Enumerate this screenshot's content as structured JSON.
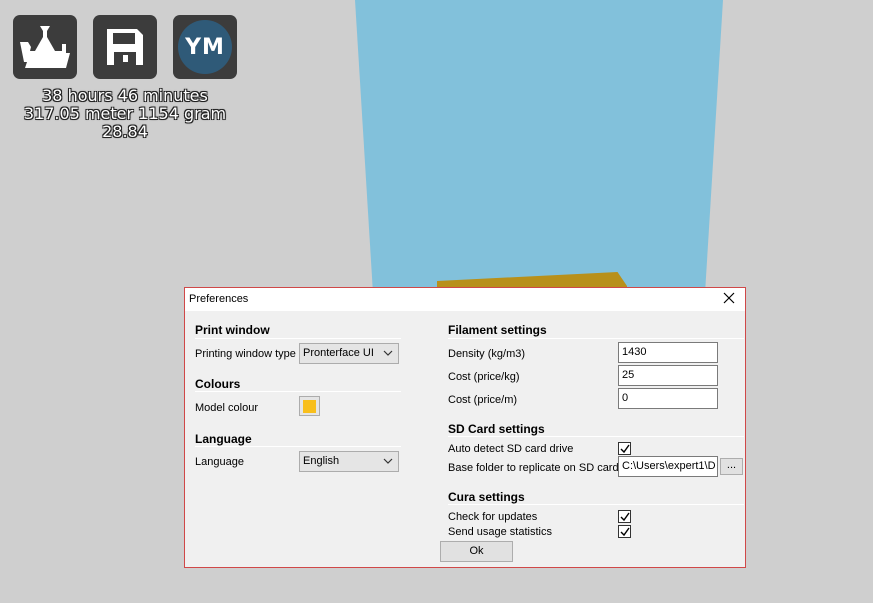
{
  "toolbar": {
    "load_icon": "load-model-icon",
    "save_icon": "save-floppy-icon",
    "account_initials": "YM"
  },
  "print_info": {
    "time": "38 hours 46 minutes",
    "material": "317.05 meter 1154 gram",
    "cost": "28.84"
  },
  "colors": {
    "model_colour": "#f8bf1c",
    "build_volume": "#82c1db"
  },
  "dialog": {
    "title": "Preferences",
    "print_window": {
      "heading": "Print window",
      "type_label": "Printing window type",
      "type_value": "Pronterface UI"
    },
    "colours": {
      "heading": "Colours",
      "model_colour_label": "Model colour"
    },
    "language": {
      "heading": "Language",
      "label": "Language",
      "value": "English"
    },
    "filament": {
      "heading": "Filament settings",
      "density_label": "Density (kg/m3)",
      "density_value": "1430",
      "cost_kg_label": "Cost (price/kg)",
      "cost_kg_value": "25",
      "cost_m_label": "Cost (price/m)",
      "cost_m_value": "0"
    },
    "sd_card": {
      "heading": "SD Card settings",
      "auto_detect_label": "Auto detect SD card drive",
      "auto_detect_checked": true,
      "base_folder_label": "Base folder to replicate on SD card",
      "base_folder_value": "C:\\Users\\expert1\\D",
      "browse_label": "..."
    },
    "cura": {
      "heading": "Cura settings",
      "updates_label": "Check for updates",
      "updates_checked": true,
      "stats_label": "Send usage statistics",
      "stats_checked": true
    },
    "ok_label": "Ok"
  }
}
